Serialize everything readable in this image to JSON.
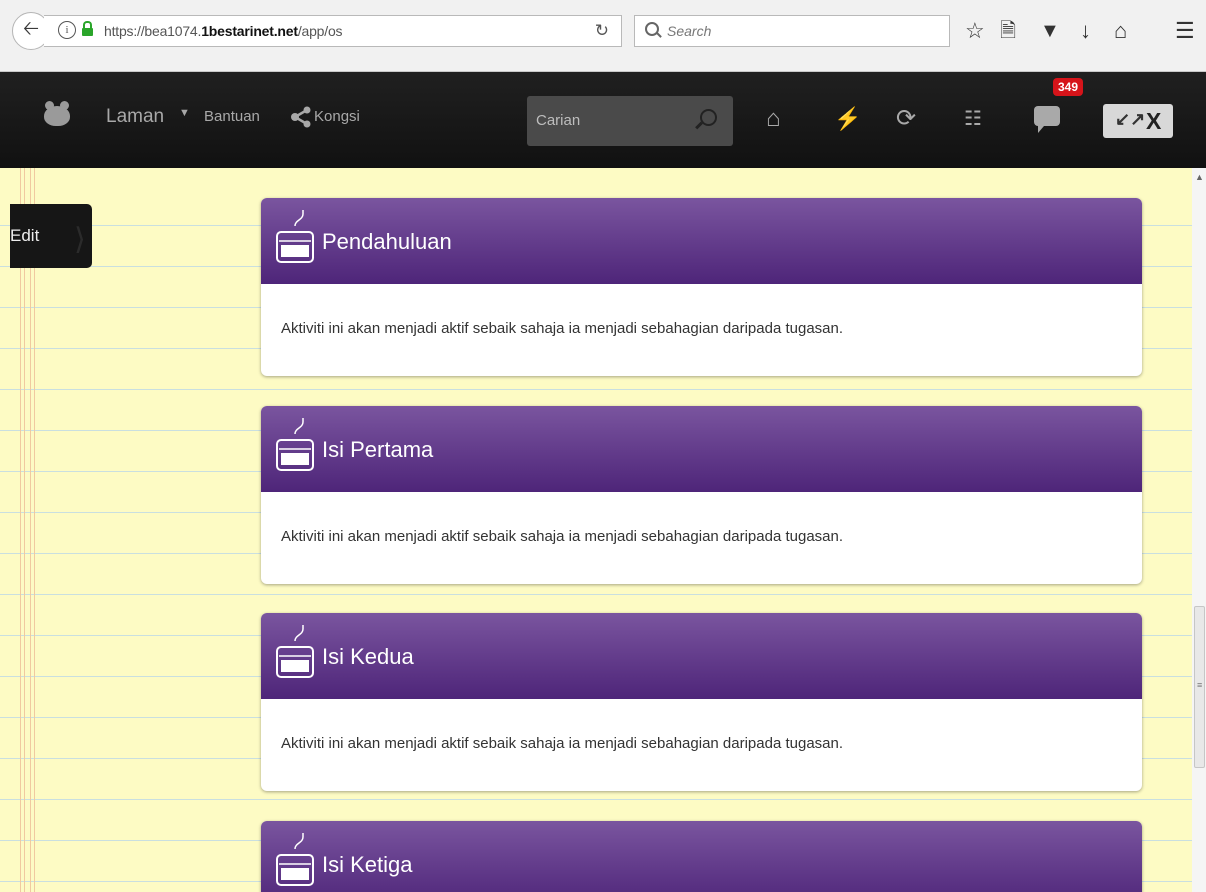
{
  "browser": {
    "url_prefix": "https://bea1074.",
    "url_domain": "1bestarinet.net",
    "url_path": "/app/os",
    "search_placeholder": "Search"
  },
  "appbar": {
    "nav_laman": "Laman",
    "nav_bantuan": "Bantuan",
    "nav_kongsi": "Kongsi",
    "search_placeholder": "Carian",
    "notification_count": "349"
  },
  "sidebar": {
    "edit_label": "Edit"
  },
  "cards": [
    {
      "title": "Pendahuluan",
      "text": "Aktiviti ini akan menjadi aktif sebaik sahaja ia menjadi sebahagian daripada tugasan."
    },
    {
      "title": "Isi Pertama",
      "text": "Aktiviti ini akan menjadi aktif sebaik sahaja ia menjadi sebahagian daripada tugasan."
    },
    {
      "title": "Isi Kedua",
      "text": "Aktiviti ini akan menjadi aktif sebaik sahaja ia menjadi sebahagian daripada tugasan."
    },
    {
      "title": "Isi Ketiga",
      "text": ""
    }
  ],
  "colors": {
    "card_header_top": "#7a559f",
    "card_header_bottom": "#4e2579",
    "page_bg": "#fdfbc4",
    "badge": "#d6141a"
  }
}
